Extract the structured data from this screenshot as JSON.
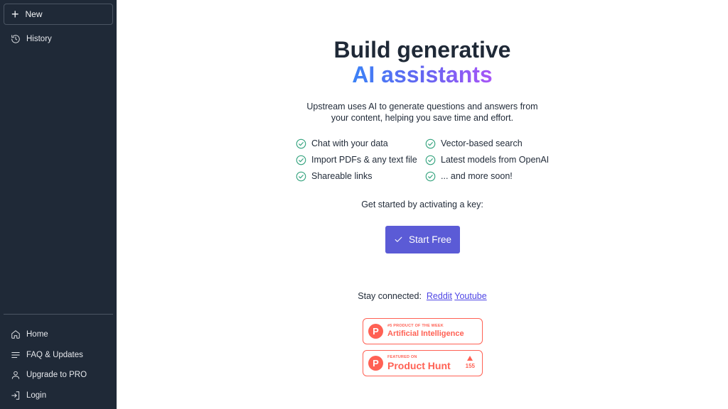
{
  "sidebar": {
    "new_label": "New",
    "history_label": "History",
    "bottom_items": [
      {
        "label": "Home",
        "icon": "home-icon"
      },
      {
        "label": "FAQ & Updates",
        "icon": "menu-lines-icon"
      },
      {
        "label": "Upgrade to PRO",
        "icon": "user-icon"
      },
      {
        "label": "Login",
        "icon": "login-icon"
      }
    ]
  },
  "hero": {
    "title_line1": "Build generative",
    "title_line2": "AI assistants",
    "subtitle_line1": "Upstream uses AI to generate questions and answers from",
    "subtitle_line2": "your content, helping you save time and effort."
  },
  "features": [
    "Chat with your data",
    "Vector-based search",
    "Import PDFs & any text file",
    "Latest models from OpenAI",
    "Shareable links",
    "... and more soon!"
  ],
  "cta": {
    "prompt": "Get started by activating a key:",
    "button_label": "Start Free"
  },
  "social": {
    "prefix": "Stay connected:",
    "reddit": "Reddit",
    "youtube": "Youtube"
  },
  "badges": {
    "potw_small": "#5 PRODUCT OF THE WEEK",
    "potw_big": "Artificial Intelligence",
    "featured_small": "FEATURED ON",
    "featured_big": "Product Hunt",
    "votes": "155",
    "logo_letter": "P"
  },
  "colors": {
    "sidebar_bg": "#1f2937",
    "accent": "#5b5bd6",
    "check": "#34a37e",
    "product_hunt": "#ff6154"
  }
}
